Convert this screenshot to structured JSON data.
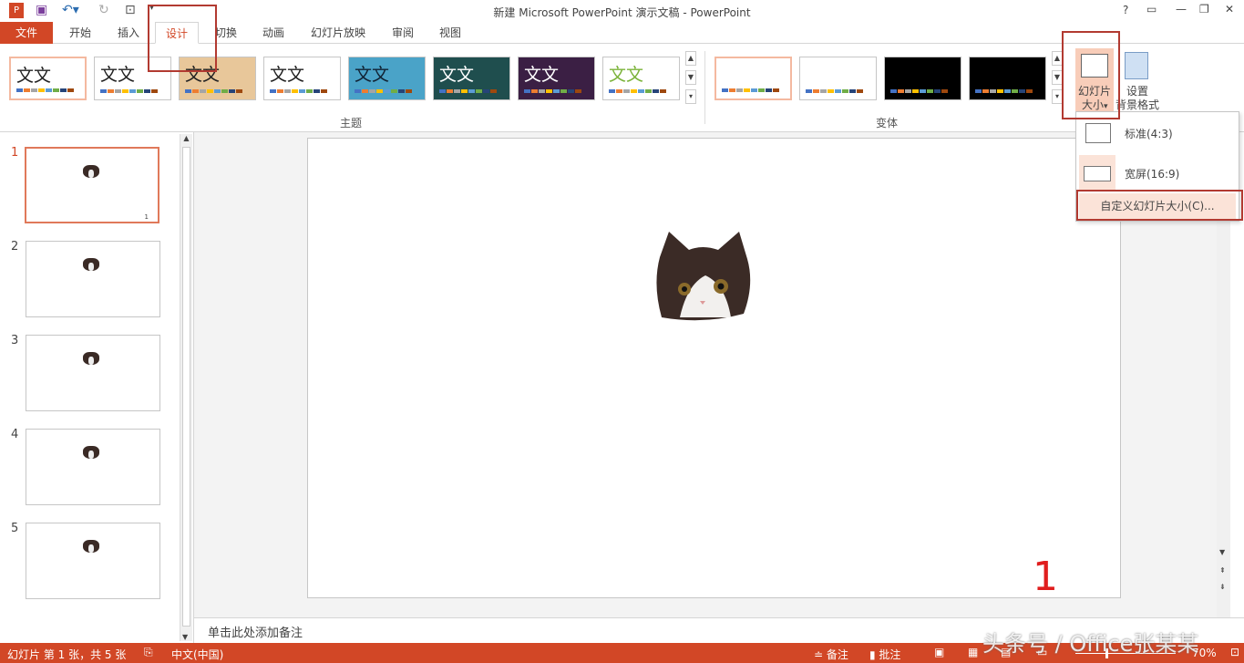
{
  "window": {
    "title": "新建 Microsoft PowerPoint 演示文稿 - PowerPoint",
    "help": "?",
    "controls": [
      "?",
      "▭",
      "—",
      "❐",
      "✕"
    ]
  },
  "tabs": [
    {
      "label": "文件"
    },
    {
      "label": "开始"
    },
    {
      "label": "插入"
    },
    {
      "label": "设计"
    },
    {
      "label": "切换"
    },
    {
      "label": "动画"
    },
    {
      "label": "幻灯片放映"
    },
    {
      "label": "审阅"
    },
    {
      "label": "视图"
    }
  ],
  "ribbon": {
    "themes_label": "主题",
    "variants_label": "变体",
    "theme_text": "文文",
    "themes": [
      {
        "bg": "#ffffff",
        "fg": "#222"
      },
      {
        "bg": "#ffffff",
        "fg": "#222"
      },
      {
        "bg": "#e8c79a",
        "fg": "#222"
      },
      {
        "bg": "#ffffff",
        "fg": "#222"
      },
      {
        "bg": "#4aa3c8",
        "fg": "#123"
      },
      {
        "bg": "#1f4e4e",
        "fg": "#fff"
      },
      {
        "bg": "#3b1f44",
        "fg": "#fff"
      },
      {
        "bg": "#ffffff",
        "fg": "#7bb33a"
      }
    ],
    "variants": [
      {
        "bg": "#ffffff"
      },
      {
        "bg": "#ffffff"
      },
      {
        "bg": "#000000"
      },
      {
        "bg": "#000000"
      }
    ],
    "slide_size_label_1": "幻灯片",
    "slide_size_label_2": "大小",
    "slide_size_arrow": "▾",
    "format_bg_label_1": "设置",
    "format_bg_label_2": "背景格式"
  },
  "dropdown": {
    "items": [
      {
        "label": "标准(4:3)"
      },
      {
        "label": "宽屏(16:9)"
      }
    ],
    "custom": "自定义幻灯片大小(C)..."
  },
  "slides": [
    {
      "num": "1"
    },
    {
      "num": "2"
    },
    {
      "num": "3"
    },
    {
      "num": "4"
    },
    {
      "num": "5"
    }
  ],
  "slide1_page": "1",
  "annotation": "1",
  "notes_placeholder": "单击此处添加备注",
  "status": {
    "slide_info": "幻灯片 第 1 张，共 5 张",
    "language": "中文(中国)",
    "notes": "备注",
    "comments": "批注",
    "zoom": "70%"
  },
  "watermark": "头条号 / Office张某某",
  "colors": {
    "accent": "#d24726",
    "highlight": "#b23a31"
  }
}
